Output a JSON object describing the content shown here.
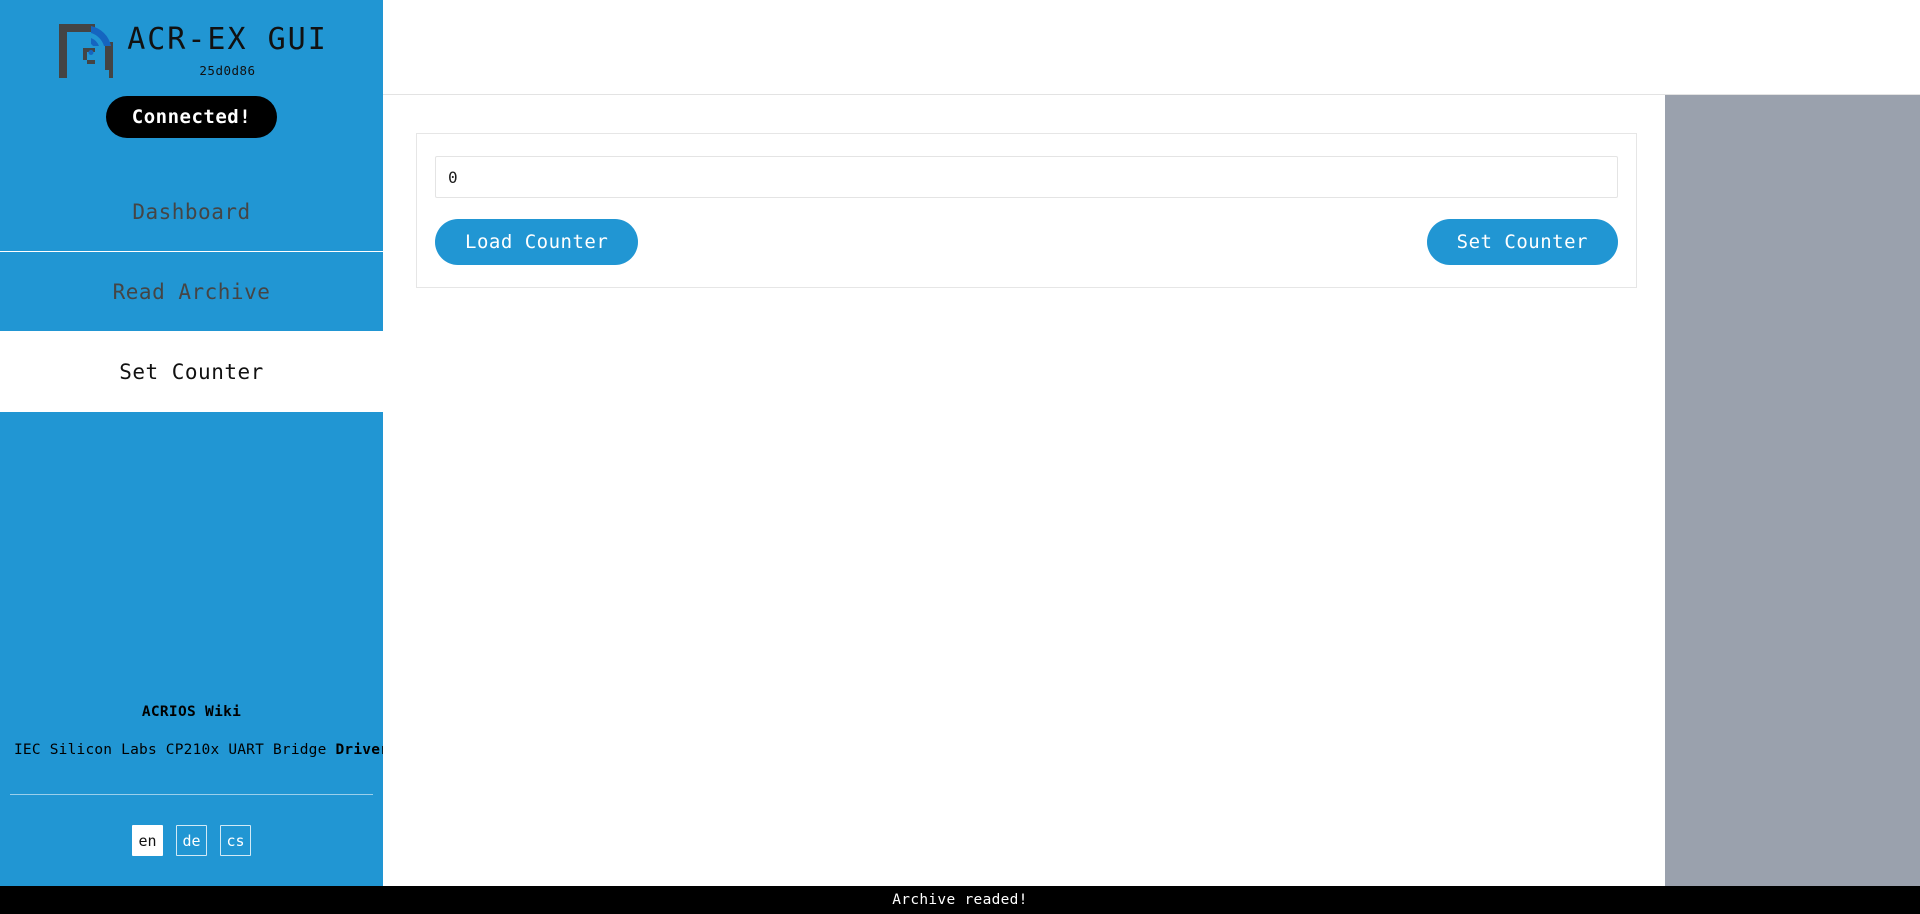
{
  "brand": {
    "title": "ACR-EX GUI",
    "version": "25d0d86",
    "logo_icon": "acrios-signal-logo-icon"
  },
  "connection": {
    "label": "Connected!",
    "state": "connected"
  },
  "sidebar": {
    "items": [
      {
        "label": "Dashboard",
        "active": false,
        "name": "sidebar-item-dashboard"
      },
      {
        "label": "Read Archive",
        "active": false,
        "name": "sidebar-item-read-archive"
      },
      {
        "label": "Set Counter",
        "active": true,
        "name": "sidebar-item-set-counter"
      }
    ],
    "links": {
      "wiki_label": "ACRIOS Wiki",
      "drivers_prefix": "IEC Silicon Labs CP210x UART Bridge ",
      "drivers_label": "Drivers"
    },
    "languages": [
      {
        "code": "en",
        "active": true
      },
      {
        "code": "de",
        "active": false
      },
      {
        "code": "cs",
        "active": false
      }
    ]
  },
  "main": {
    "counter": {
      "value": "0",
      "placeholder": "0",
      "load_label": "Load Counter",
      "set_label": "Set Counter"
    }
  },
  "statusbar": {
    "message": "Archive readed!"
  },
  "colors": {
    "brand_blue": "#2196d3",
    "status_bar_bg": "#000000",
    "gray_panel": "#9aa1ad",
    "nav_text": "#454545"
  }
}
